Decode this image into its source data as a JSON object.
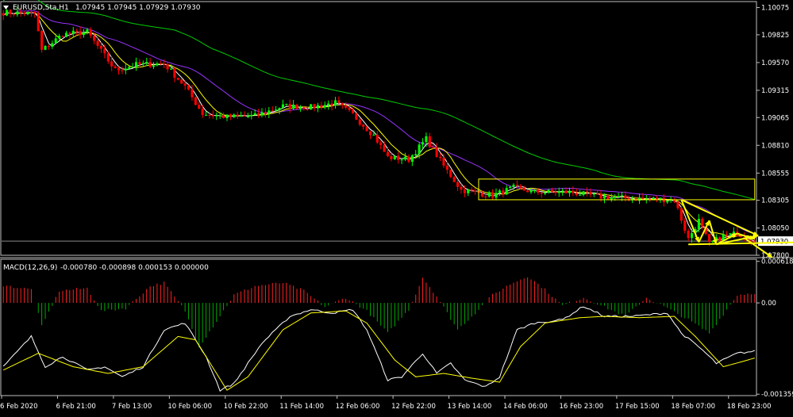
{
  "header": {
    "symbol_label": "EURUSD,Sta,H1",
    "ohlc": "1.07945 1.07945 1.07929 1.07930"
  },
  "macd_header": {
    "label": "MACD(12,26,9)",
    "values": "-0.000780 -0.000898 0.000153 0.000000"
  },
  "colors": {
    "background": "#000000",
    "bull_candle": "#00ff00",
    "bear_candle": "#ff0000",
    "ma_fast": "#ffffff",
    "ma_mid": "#ffff00",
    "ma_slow_purple": "#9933ff",
    "ma_long_green": "#00cc00",
    "macd_positive": "#ff2222",
    "macd_negative": "#00aa00",
    "signal_line": "#ffff00",
    "annotation": "#ffff00",
    "grid_axis": "#c0c0c0"
  },
  "icons": {
    "menu": "triangle-down-icon"
  },
  "chart_data": [
    {
      "type": "candlestick",
      "title": "EURUSD,Sta,H1",
      "ylim": [
        1.078,
        1.1013
      ],
      "y_ticks": [
        "1.10075",
        "1.09825",
        "1.09570",
        "1.09315",
        "1.09065",
        "1.08810",
        "1.08555",
        "1.08305",
        "1.08050",
        "1.07800"
      ],
      "y_tick_values": [
        1.10075,
        1.09825,
        1.0957,
        1.09315,
        1.09065,
        1.0881,
        1.08555,
        1.08305,
        1.0805,
        1.078
      ],
      "current_price": "1.07930",
      "current_price_value": 1.0793,
      "x_labels": [
        "6 Feb 2020",
        "6 Feb 21:00",
        "7 Feb 13:00",
        "10 Feb 06:00",
        "10 Feb 22:00",
        "11 Feb 14:00",
        "12 Feb 06:00",
        "12 Feb 22:00",
        "13 Feb 14:00",
        "14 Feb 06:00",
        "16 Feb 23:00",
        "17 Feb 15:00",
        "18 Feb 07:00",
        "18 Feb 23:00"
      ],
      "x_label_index": [
        0,
        16,
        32,
        48,
        64,
        80,
        96,
        112,
        128,
        144,
        160,
        176,
        192,
        208
      ],
      "close_keypoints": [
        [
          0,
          1.1003
        ],
        [
          9,
          1.1002
        ],
        [
          11,
          1.0968
        ],
        [
          17,
          1.0983
        ],
        [
          24,
          1.0985
        ],
        [
          32,
          1.095
        ],
        [
          38,
          1.0955
        ],
        [
          46,
          1.0956
        ],
        [
          52,
          1.0935
        ],
        [
          57,
          1.091
        ],
        [
          64,
          1.0907
        ],
        [
          72,
          1.0908
        ],
        [
          80,
          1.0917
        ],
        [
          88,
          1.0916
        ],
        [
          95,
          1.092
        ],
        [
          100,
          1.0909
        ],
        [
          106,
          1.089
        ],
        [
          110,
          1.087
        ],
        [
          116,
          1.0868
        ],
        [
          121,
          1.0887
        ],
        [
          126,
          1.0862
        ],
        [
          131,
          1.084
        ],
        [
          140,
          1.0835
        ],
        [
          146,
          1.0842
        ],
        [
          152,
          1.0838
        ],
        [
          162,
          1.0838
        ],
        [
          170,
          1.0834
        ],
        [
          180,
          1.0832
        ],
        [
          192,
          1.0831
        ],
        [
          196,
          1.0795
        ],
        [
          199,
          1.0812
        ],
        [
          202,
          1.079
        ],
        [
          206,
          1.0798
        ],
        [
          210,
          1.08
        ],
        [
          215,
          1.0793
        ]
      ],
      "annotations": {
        "rectangle": {
          "x": [
            136,
            215
          ],
          "y": [
            1.0831,
            1.085
          ]
        },
        "lines": [
          [
            [
              194,
              1.0831
            ],
            [
              216,
              1.0798
            ]
          ],
          [
            [
              194,
              1.0831
            ],
            [
              199,
              1.0792
            ]
          ],
          [
            [
              199,
              1.0792
            ],
            [
              202,
              1.0812
            ]
          ],
          [
            [
              202,
              1.0812
            ],
            [
              204,
              1.079
            ]
          ],
          [
            [
              204,
              1.079
            ],
            [
              210,
              1.08
            ]
          ],
          [
            [
              210,
              1.08
            ],
            [
              215,
              1.0795
            ]
          ],
          [
            [
              196,
              1.079
            ],
            [
              229,
              1.0792
            ]
          ],
          [
            [
              204,
              1.079
            ],
            [
              216,
              1.0798
            ]
          ],
          [
            [
              212,
              1.0796
            ],
            [
              220,
              1.0778
            ]
          ]
        ]
      }
    },
    {
      "type": "histogram_line",
      "title": "MACD(12,26,9)",
      "ylim": [
        -0.00138,
        0.00065
      ],
      "y_ticks": [
        "0.000618",
        "0.00",
        "-0.001359"
      ],
      "y_tick_values": [
        0.000618,
        0.0,
        -0.001359
      ],
      "histogram_keypoints": [
        [
          0,
          0.00026
        ],
        [
          8,
          0.0002
        ],
        [
          11,
          -0.00035
        ],
        [
          16,
          0.00018
        ],
        [
          24,
          0.00022
        ],
        [
          28,
          -0.00012
        ],
        [
          35,
          -8e-05
        ],
        [
          42,
          0.00025
        ],
        [
          46,
          0.0003
        ],
        [
          52,
          -0.00012
        ],
        [
          56,
          -0.00065
        ],
        [
          60,
          -0.00035
        ],
        [
          66,
          0.00012
        ],
        [
          72,
          0.00025
        ],
        [
          80,
          0.0003
        ],
        [
          86,
          0.00018
        ],
        [
          92,
          -6e-05
        ],
        [
          98,
          8e-05
        ],
        [
          104,
          -0.00012
        ],
        [
          110,
          -0.00045
        ],
        [
          116,
          -0.0001
        ],
        [
          120,
          0.00038
        ],
        [
          124,
          0.0001
        ],
        [
          130,
          -0.0004
        ],
        [
          135,
          -0.00015
        ],
        [
          140,
          0.00012
        ],
        [
          145,
          0.00028
        ],
        [
          150,
          0.0004
        ],
        [
          155,
          0.0002
        ],
        [
          160,
          -4e-05
        ],
        [
          166,
          8e-05
        ],
        [
          172,
          -6e-05
        ],
        [
          178,
          -0.0002
        ],
        [
          184,
          8e-05
        ],
        [
          190,
          -8e-05
        ],
        [
          196,
          -0.00025
        ],
        [
          202,
          -0.00045
        ],
        [
          207,
          -0.0001
        ],
        [
          210,
          0.00012
        ],
        [
          215,
          0.00015
        ]
      ],
      "macd_keypoints": [
        [
          0,
          -0.00095
        ],
        [
          8,
          -0.0005
        ],
        [
          12,
          -0.00095
        ],
        [
          17,
          -0.0008
        ],
        [
          24,
          -0.001
        ],
        [
          29,
          -0.00095
        ],
        [
          34,
          -0.0011
        ],
        [
          40,
          -0.00095
        ],
        [
          46,
          -0.0004
        ],
        [
          52,
          -0.0003
        ],
        [
          58,
          -0.0008
        ],
        [
          62,
          -0.0013
        ],
        [
          66,
          -0.0012
        ],
        [
          74,
          -0.0006
        ],
        [
          82,
          -0.0002
        ],
        [
          88,
          -0.0001
        ],
        [
          94,
          -0.00015
        ],
        [
          100,
          -0.0001
        ],
        [
          104,
          -0.0004
        ],
        [
          110,
          -0.00115
        ],
        [
          114,
          -0.0011
        ],
        [
          120,
          -0.00075
        ],
        [
          124,
          -0.00105
        ],
        [
          128,
          -0.0009
        ],
        [
          132,
          -0.00115
        ],
        [
          138,
          -0.00125
        ],
        [
          142,
          -0.0011
        ],
        [
          147,
          -0.0004
        ],
        [
          152,
          -0.0003
        ],
        [
          160,
          -0.00025
        ],
        [
          166,
          -5e-05
        ],
        [
          172,
          -0.0002
        ],
        [
          180,
          -0.0002
        ],
        [
          190,
          -0.00015
        ],
        [
          194,
          -0.00045
        ],
        [
          200,
          -0.0007
        ],
        [
          204,
          -0.0009
        ],
        [
          210,
          -0.00075
        ],
        [
          215,
          -0.00072
        ]
      ],
      "signal_keypoints": [
        [
          0,
          -0.001
        ],
        [
          10,
          -0.00075
        ],
        [
          20,
          -0.00095
        ],
        [
          30,
          -0.00105
        ],
        [
          40,
          -0.00095
        ],
        [
          50,
          -0.0005
        ],
        [
          55,
          -0.00055
        ],
        [
          64,
          -0.0013
        ],
        [
          70,
          -0.0011
        ],
        [
          80,
          -0.0004
        ],
        [
          88,
          -0.00015
        ],
        [
          98,
          -0.00012
        ],
        [
          104,
          -0.0003
        ],
        [
          112,
          -0.00085
        ],
        [
          118,
          -0.0011
        ],
        [
          126,
          -0.00105
        ],
        [
          134,
          -0.00112
        ],
        [
          142,
          -0.00118
        ],
        [
          148,
          -0.00065
        ],
        [
          155,
          -0.0003
        ],
        [
          165,
          -0.00022
        ],
        [
          172,
          -0.0002
        ],
        [
          182,
          -0.00022
        ],
        [
          192,
          -0.0002
        ],
        [
          198,
          -0.0005
        ],
        [
          206,
          -0.00095
        ],
        [
          211,
          -0.00088
        ],
        [
          215,
          -0.00082
        ]
      ]
    }
  ]
}
